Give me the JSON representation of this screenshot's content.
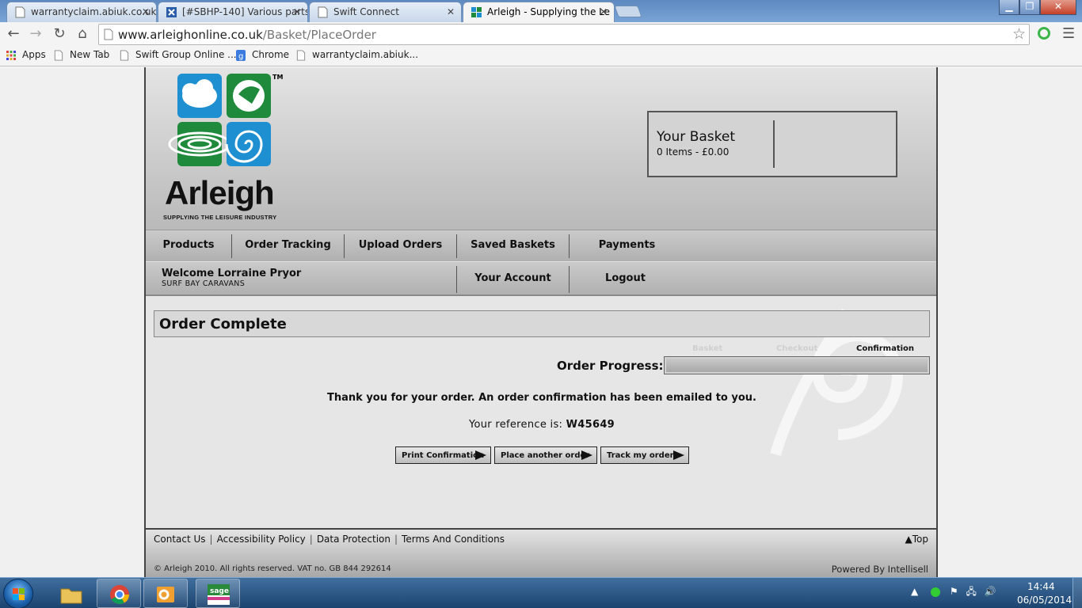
{
  "browser": {
    "tabs": [
      {
        "title": "warrantyclaim.abiuk.co.uk",
        "active": false
      },
      {
        "title": "[#SBHP-140] Various parts",
        "active": false
      },
      {
        "title": "Swift Connect",
        "active": false
      },
      {
        "title": "Arleigh - Supplying the Le",
        "active": true
      }
    ],
    "url_domain": "www.arleighonline.co.uk",
    "url_path": "/Basket/PlaceOrder",
    "bookmarks": [
      "Apps",
      "New Tab",
      "Swift Group Online ...",
      "Chrome",
      "warrantyclaim.abiuk..."
    ]
  },
  "site": {
    "brand_name": "Arleigh",
    "brand_tagline": "SUPPLYING THE LEISURE INDUSTRY",
    "trademark": "TM",
    "basket": {
      "title": "Your Basket",
      "summary": "0 Items - £0.00"
    },
    "nav_main": [
      "Products",
      "Order Tracking",
      "Upload Orders",
      "Saved Baskets",
      "Payments"
    ],
    "welcome": "Welcome Lorraine Pryor",
    "company": "SURF BAY CARAVANS",
    "nav_account": [
      "Your Account",
      "Logout"
    ]
  },
  "order": {
    "page_title": "Order Complete",
    "steps": [
      {
        "label": "Basket",
        "state": "done"
      },
      {
        "label": "Checkout",
        "state": "done"
      },
      {
        "label": "Confirmation",
        "state": "current"
      }
    ],
    "progress_label": "Order Progress:",
    "progress_fraction": 1.0,
    "thanks_message": "Thank you for your order. An order confirmation has been emailed to you.",
    "reference_label": "Your reference is:",
    "reference_value": "W45649",
    "actions": [
      "Print Confirmation",
      "Place another order",
      "Track my orders"
    ]
  },
  "footer": {
    "links": [
      "Contact Us",
      "Accessibility Policy",
      "Data Protection",
      "Terms And Conditions"
    ],
    "top_link": "▲Top",
    "copyright": "© Arleigh 2010. All rights reserved. VAT no. GB 844 292614",
    "powered_by": "Powered By Intellisell"
  },
  "taskbar": {
    "time": "14:44",
    "date": "06/05/2014"
  },
  "colors": {
    "logo_blue": "#1e8fd0",
    "logo_green": "#1f8a3c",
    "taskbar": "#1c4470"
  }
}
